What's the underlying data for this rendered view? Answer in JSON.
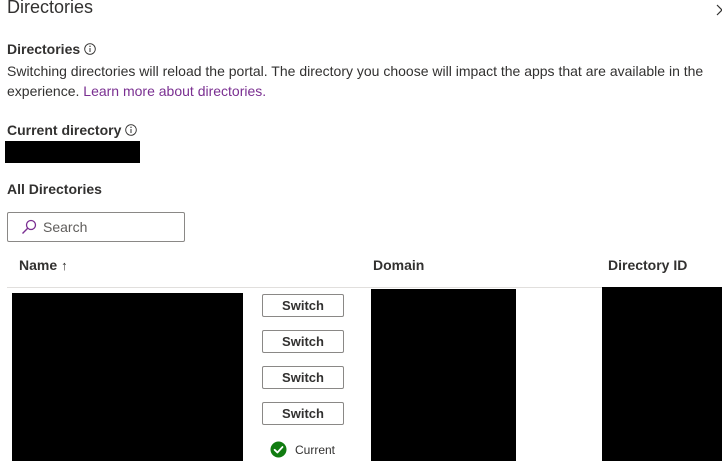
{
  "panel": {
    "title": "Directories"
  },
  "directories_section": {
    "label": "Directories",
    "description": "Switching directories will reload the portal. The directory you choose will impact the apps that are available in the experience.",
    "learn_more_link": "Learn more about directories."
  },
  "current_directory": {
    "label": "Current directory"
  },
  "all_directories": {
    "label": "All Directories",
    "search_placeholder": "Search",
    "columns": {
      "name": "Name",
      "name_sort_indicator": "↑",
      "domain": "Domain",
      "directory_id": "Directory ID"
    },
    "rows": [
      {
        "action": "Switch"
      },
      {
        "action": "Switch"
      },
      {
        "action": "Switch"
      },
      {
        "action": "Switch"
      },
      {
        "status": "Current"
      }
    ]
  },
  "colors": {
    "link": "#7a2f91",
    "current_check": "#107c10",
    "search_icon": "#7a2f91",
    "redaction": "#000000"
  },
  "icons": {
    "info": "info-icon",
    "close": "close-icon",
    "search": "search-icon",
    "current": "checkmark-circle-icon"
  }
}
